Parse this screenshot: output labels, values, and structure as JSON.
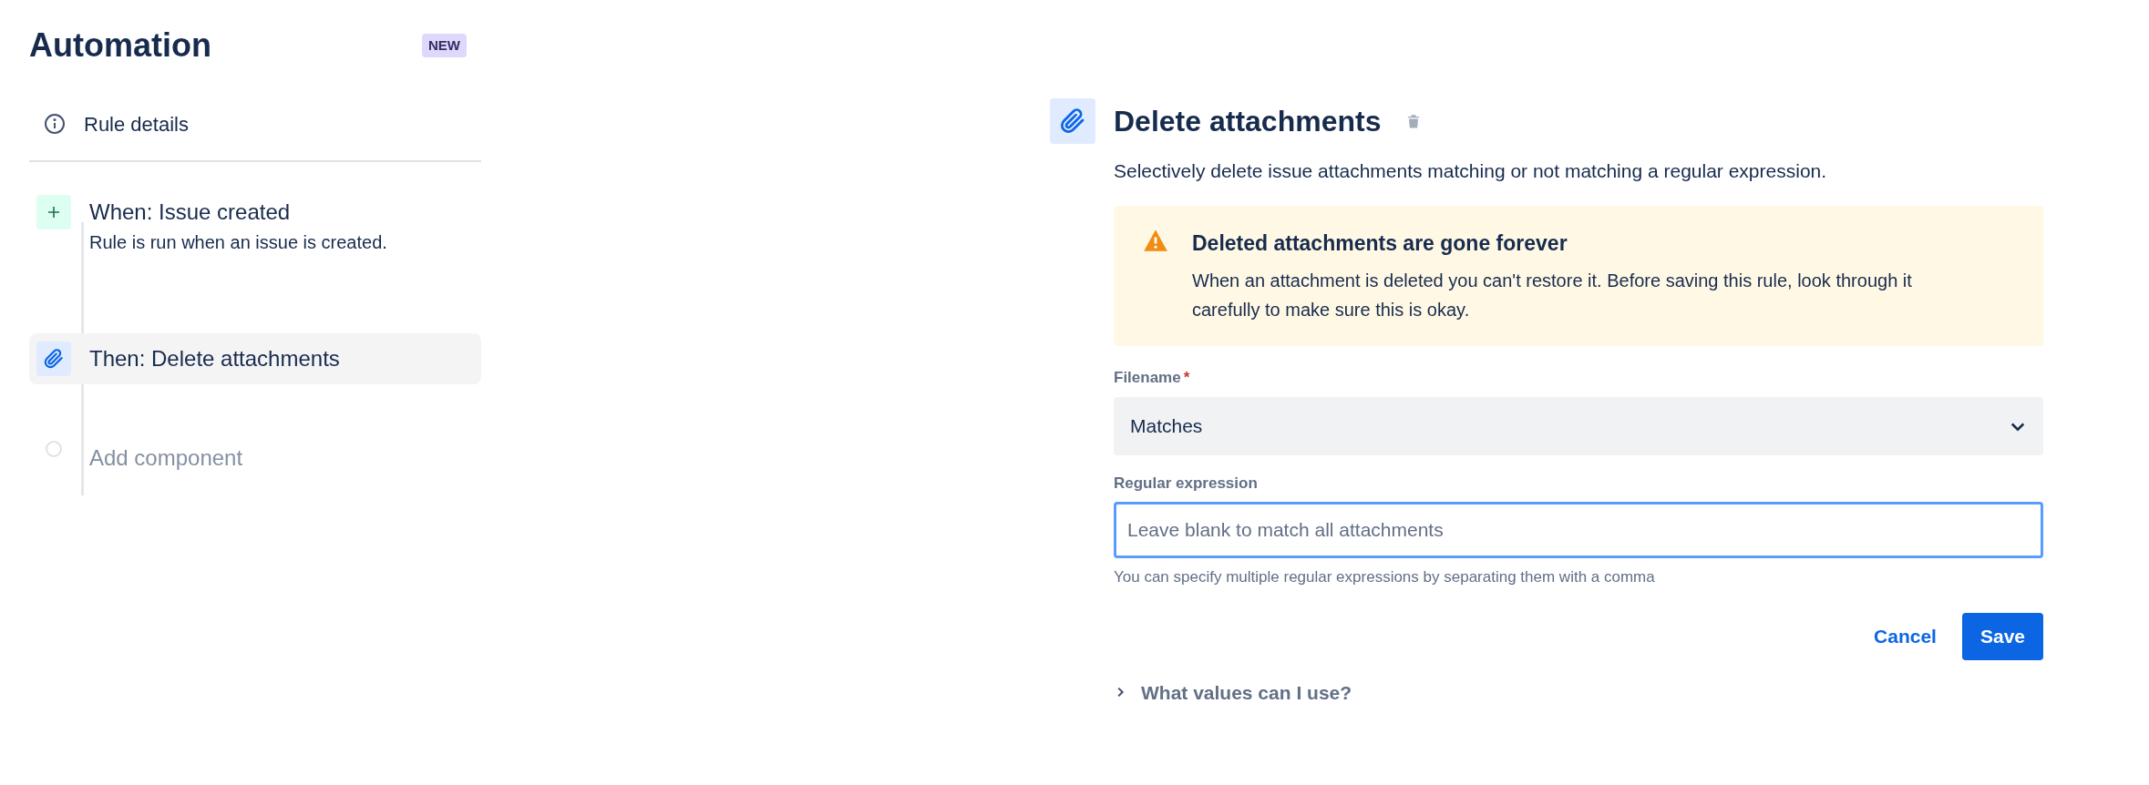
{
  "sidebar": {
    "title": "Automation",
    "badge": "NEW",
    "rule_details": "Rule details",
    "steps": [
      {
        "kind": "trigger",
        "title": "When: Issue created",
        "subtitle": "Rule is run when an issue is created.",
        "selected": false
      },
      {
        "kind": "action",
        "title": "Then: Delete attachments",
        "selected": true
      },
      {
        "kind": "add",
        "title": "Add component",
        "selected": false
      }
    ]
  },
  "panel": {
    "title": "Delete attachments",
    "description": "Selectively delete issue attachments matching or not matching a regular expression.",
    "warning": {
      "title": "Deleted attachments are gone forever",
      "body": "When an attachment is deleted you can't restore it. Before saving this rule, look through it carefully to make sure this is okay."
    },
    "filename": {
      "label": "Filename",
      "required_mark": "*",
      "value": "Matches"
    },
    "regex": {
      "label": "Regular expression",
      "placeholder": "Leave blank to match all attachments",
      "help": "You can specify multiple regular expressions by separating them with a comma",
      "focused": true
    },
    "buttons": {
      "cancel": "Cancel",
      "save": "Save"
    },
    "expander": {
      "label": "What values can I use?",
      "expanded": false
    }
  }
}
